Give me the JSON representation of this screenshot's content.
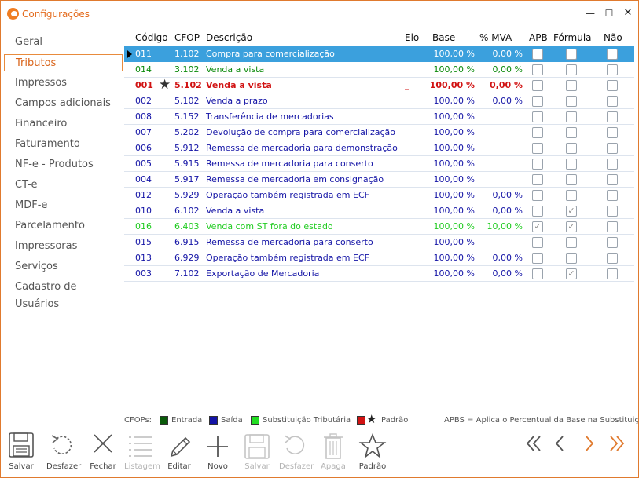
{
  "window": {
    "title": "Configurações"
  },
  "title_buttons": {
    "minimize": "—",
    "maximize": "☐",
    "close": "✕"
  },
  "sidebar": {
    "items": [
      {
        "label": "Geral",
        "active": false
      },
      {
        "label": "Tributos",
        "active": true
      },
      {
        "label": "Impressos",
        "active": false
      },
      {
        "label": "Campos adicionais",
        "active": false
      },
      {
        "label": "Financeiro",
        "active": false
      },
      {
        "label": "Faturamento",
        "active": false
      },
      {
        "label": "NF-e - Produtos",
        "active": false
      },
      {
        "label": "CT-e",
        "active": false
      },
      {
        "label": "MDF-e",
        "active": false
      },
      {
        "label": "Parcelamento",
        "active": false
      },
      {
        "label": "Impressoras",
        "active": false
      },
      {
        "label": "Serviços",
        "active": false
      },
      {
        "label": "Cadastro de Usuários",
        "active": false
      }
    ]
  },
  "table": {
    "columns": [
      "Código",
      "CFOP",
      "Descrição",
      "Elo",
      "Base",
      "% MVA",
      "APB",
      "Fórmula",
      "Não"
    ],
    "rows": [
      {
        "codigo": "011",
        "cfop": "1.102",
        "descricao": "Compra para comercialização",
        "elo": "",
        "base": "100,00 %",
        "mva": "0,00 %",
        "apb": false,
        "formula": false,
        "nao": false,
        "kind": "entrada",
        "selected": true,
        "padrao": false
      },
      {
        "codigo": "014",
        "cfop": "3.102",
        "descricao": "Venda a vista",
        "elo": "",
        "base": "100,00 %",
        "mva": "0,00 %",
        "apb": false,
        "formula": false,
        "nao": false,
        "kind": "entrada",
        "selected": false,
        "padrao": false
      },
      {
        "codigo": "001",
        "cfop": "5.102",
        "descricao": "Venda a vista",
        "elo": "_",
        "base": "100,00 %",
        "mva": "0,00 %",
        "apb": false,
        "formula": false,
        "nao": false,
        "kind": "padrao",
        "selected": false,
        "padrao": true
      },
      {
        "codigo": "002",
        "cfop": "5.102",
        "descricao": "Venda a prazo",
        "elo": "",
        "base": "100,00 %",
        "mva": "0,00 %",
        "apb": false,
        "formula": false,
        "nao": false,
        "kind": "saida",
        "selected": false,
        "padrao": false
      },
      {
        "codigo": "008",
        "cfop": "5.152",
        "descricao": "Transferência de mercadorias",
        "elo": "",
        "base": "100,00 %",
        "mva": "",
        "apb": false,
        "formula": false,
        "nao": false,
        "kind": "saida",
        "selected": false,
        "padrao": false
      },
      {
        "codigo": "007",
        "cfop": "5.202",
        "descricao": "Devolução de compra para comercialização",
        "elo": "",
        "base": "100,00 %",
        "mva": "",
        "apb": false,
        "formula": false,
        "nao": false,
        "kind": "saida",
        "selected": false,
        "padrao": false
      },
      {
        "codigo": "006",
        "cfop": "5.912",
        "descricao": "Remessa de mercadoria para demonstração",
        "elo": "",
        "base": "100,00 %",
        "mva": "",
        "apb": false,
        "formula": false,
        "nao": false,
        "kind": "saida",
        "selected": false,
        "padrao": false
      },
      {
        "codigo": "005",
        "cfop": "5.915",
        "descricao": "Remessa de mercadoria para conserto",
        "elo": "",
        "base": "100,00 %",
        "mva": "",
        "apb": false,
        "formula": false,
        "nao": false,
        "kind": "saida",
        "selected": false,
        "padrao": false
      },
      {
        "codigo": "004",
        "cfop": "5.917",
        "descricao": "Remessa de mercadoria em consignação",
        "elo": "",
        "base": "100,00 %",
        "mva": "",
        "apb": false,
        "formula": false,
        "nao": false,
        "kind": "saida",
        "selected": false,
        "padrao": false
      },
      {
        "codigo": "012",
        "cfop": "5.929",
        "descricao": "Operação também registrada em ECF",
        "elo": "",
        "base": "100,00 %",
        "mva": "0,00 %",
        "apb": false,
        "formula": false,
        "nao": false,
        "kind": "saida",
        "selected": false,
        "padrao": false
      },
      {
        "codigo": "010",
        "cfop": "6.102",
        "descricao": "Venda a vista",
        "elo": "",
        "base": "100,00 %",
        "mva": "0,00 %",
        "apb": false,
        "formula": true,
        "nao": false,
        "kind": "saida",
        "selected": false,
        "padrao": false
      },
      {
        "codigo": "016",
        "cfop": "6.403",
        "descricao": "Venda com ST fora do estado",
        "elo": "",
        "base": "100,00 %",
        "mva": "10,00 %",
        "apb": true,
        "formula": true,
        "nao": false,
        "kind": "st",
        "selected": false,
        "padrao": false
      },
      {
        "codigo": "015",
        "cfop": "6.915",
        "descricao": "Remessa de mercadoria para conserto",
        "elo": "",
        "base": "100,00 %",
        "mva": "",
        "apb": false,
        "formula": false,
        "nao": false,
        "kind": "saida",
        "selected": false,
        "padrao": false
      },
      {
        "codigo": "013",
        "cfop": "6.929",
        "descricao": "Operação também registrada em ECF",
        "elo": "",
        "base": "100,00 %",
        "mva": "0,00 %",
        "apb": false,
        "formula": false,
        "nao": false,
        "kind": "saida",
        "selected": false,
        "padrao": false
      },
      {
        "codigo": "003",
        "cfop": "7.102",
        "descricao": "Exportação de Mercadoria",
        "elo": "",
        "base": "100,00 %",
        "mva": "0,00 %",
        "apb": false,
        "formula": true,
        "nao": false,
        "kind": "saida",
        "selected": false,
        "padrao": false
      }
    ]
  },
  "legend": {
    "title": "CFOPs:",
    "items": [
      {
        "label": "Entrada",
        "color": "#0a5a0a"
      },
      {
        "label": "Saída",
        "color": "#1414a6"
      },
      {
        "label": "Substituição Tributária",
        "color": "#22dd22"
      },
      {
        "label": "Padrão",
        "color": "#d11313"
      }
    ],
    "note": "APBS = Aplica o Percentual da Base na Substituição"
  },
  "left_actions": [
    {
      "label": "Salvar",
      "icon": "save-icon"
    },
    {
      "label": "Desfazer",
      "icon": "undo-icon"
    },
    {
      "label": "Fechar",
      "icon": "close-icon"
    }
  ],
  "toolbar": [
    {
      "label": "Listagem",
      "icon": "list-icon",
      "enabled": false
    },
    {
      "label": "Editar",
      "icon": "pencil-icon",
      "enabled": true
    },
    {
      "label": "Novo",
      "icon": "plus-icon",
      "enabled": true
    },
    {
      "label": "Salvar",
      "icon": "save-icon",
      "enabled": false
    },
    {
      "label": "Desfazer",
      "icon": "undo-icon",
      "enabled": false
    },
    {
      "label": "Apaga",
      "icon": "trash-icon",
      "enabled": false
    },
    {
      "label": "Padrão",
      "icon": "star-icon",
      "enabled": true
    }
  ],
  "navigation": [
    "first-icon",
    "prev-icon",
    "next-icon",
    "last-icon"
  ],
  "colors": {
    "accent": "#e46b1d",
    "selection": "#3ba0dd",
    "entrada": "#0b8a0b",
    "saida": "#1414a6",
    "st": "#22cc22",
    "padrao": "#d11313"
  }
}
